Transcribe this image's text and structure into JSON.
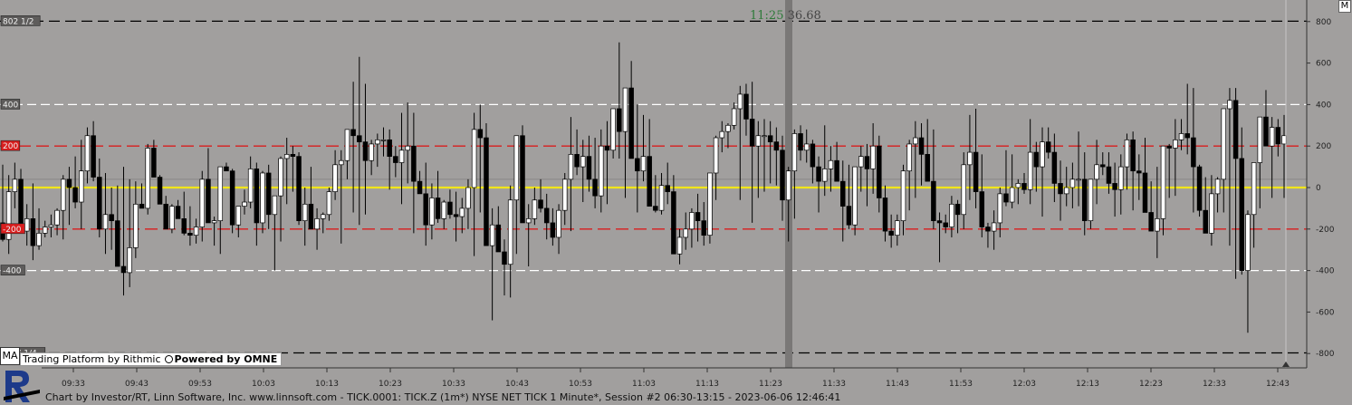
{
  "overlay": {
    "time_label": "11:25",
    "price_label": "36.68",
    "ma_label": "MA",
    "rithmic_text": "Trading Platform by Rithmic",
    "omne_text": "Powered by OMNE",
    "corner_label": "M",
    "footer_text": "Chart by Investor/RT, Linn Software, Inc. www.linnsoft.com - TICK.0001: TICK.Z (1m*) NYSE NET TICK 1 Minute*, Session #2 06:30-13:15 - 2023-06-06 12:46:41"
  },
  "colors": {
    "background": "#a19f9e",
    "bull_fill": "#ffffff",
    "bear_fill": "#000000",
    "wick": "#000000",
    "zero_line": "#f2e61a",
    "red_line": "#d91e1e",
    "white_line": "#ffffff",
    "dark_line": "#000000",
    "cursor": "#7a7877"
  },
  "chart_data": {
    "type": "candlestick",
    "title": "",
    "xlabel": "",
    "ylabel": "",
    "ylim": [
      -900,
      900
    ],
    "y_ticks": [
      800,
      600,
      400,
      200,
      0,
      -200,
      -400,
      -600,
      -800
    ],
    "x_ticks": [
      "09:33",
      "09:43",
      "09:53",
      "10:03",
      "10:13",
      "10:23",
      "10:33",
      "10:43",
      "10:53",
      "11:03",
      "11:13",
      "11:23",
      "11:33",
      "11:43",
      "11:53",
      "12:03",
      "12:13",
      "12:23",
      "12:33",
      "12:43"
    ],
    "grid": false,
    "horizontal_levels": [
      {
        "value": 802,
        "style": "dark-dashed",
        "label": "802 1/2"
      },
      {
        "value": 400,
        "style": "white-dashed",
        "label": "400"
      },
      {
        "value": 200,
        "style": "red-dashed",
        "label": "200"
      },
      {
        "value": 0,
        "style": "yellow-solid",
        "label": ""
      },
      {
        "value": -200,
        "style": "red-dashed",
        "label": "-200"
      },
      {
        "value": -400,
        "style": "white-dashed",
        "label": "-400"
      },
      {
        "value": -797,
        "style": "dark-dashed",
        "label": "-797 1/4"
      }
    ],
    "cursor_time": "11:25",
    "cursor_value": 36.68,
    "candles": [
      [
        -170,
        110,
        -260,
        -250
      ],
      [
        -250,
        60,
        -320,
        -20
      ],
      [
        -20,
        120,
        -100,
        40
      ],
      [
        40,
        90,
        -120,
        -210
      ],
      [
        -210,
        -80,
        -280,
        -150
      ],
      [
        -150,
        20,
        -350,
        -280
      ],
      [
        -280,
        -100,
        -300,
        -220
      ],
      [
        -220,
        -160,
        -240,
        -190
      ],
      [
        -190,
        -130,
        -240,
        -180
      ],
      [
        -180,
        -100,
        -230,
        -110
      ],
      [
        -110,
        60,
        -250,
        40
      ],
      [
        40,
        100,
        -180,
        0
      ],
      [
        0,
        150,
        -100,
        -70
      ],
      [
        -70,
        230,
        -200,
        80
      ],
      [
        80,
        290,
        20,
        250
      ],
      [
        250,
        320,
        30,
        50
      ],
      [
        50,
        140,
        -240,
        -200
      ],
      [
        -200,
        70,
        -320,
        -130
      ],
      [
        -130,
        0,
        -300,
        -160
      ],
      [
        -160,
        10,
        -360,
        -380
      ],
      [
        -380,
        100,
        -520,
        -410
      ],
      [
        -410,
        40,
        -480,
        -290
      ],
      [
        -290,
        30,
        -340,
        -80
      ],
      [
        -80,
        20,
        -100,
        -100
      ],
      [
        -100,
        210,
        -130,
        190
      ],
      [
        190,
        230,
        80,
        50
      ],
      [
        50,
        60,
        -20,
        -80
      ],
      [
        -80,
        -40,
        -200,
        -200
      ],
      [
        -200,
        -80,
        -220,
        -90
      ],
      [
        -90,
        -60,
        -130,
        -150
      ],
      [
        -150,
        -20,
        -230,
        -220
      ],
      [
        -220,
        -90,
        -280,
        -230
      ],
      [
        -230,
        -150,
        -270,
        -190
      ],
      [
        -190,
        80,
        -260,
        40
      ],
      [
        40,
        190,
        -150,
        -170
      ],
      [
        -170,
        -140,
        -280,
        -160
      ],
      [
        -160,
        90,
        -320,
        100
      ],
      [
        100,
        120,
        80,
        80
      ],
      [
        80,
        90,
        -220,
        -180
      ],
      [
        -180,
        -100,
        -240,
        -90
      ],
      [
        -90,
        -10,
        -130,
        -70
      ],
      [
        -70,
        150,
        -100,
        90
      ],
      [
        90,
        120,
        -280,
        -170
      ],
      [
        -170,
        80,
        -220,
        70
      ],
      [
        70,
        110,
        -200,
        -130
      ],
      [
        -130,
        -40,
        -400,
        -40
      ],
      [
        -40,
        150,
        -260,
        140
      ],
      [
        140,
        240,
        -80,
        160
      ],
      [
        160,
        200,
        -20,
        150
      ],
      [
        150,
        170,
        -180,
        -160
      ],
      [
        -160,
        0,
        -280,
        -80
      ],
      [
        -80,
        100,
        -170,
        -200
      ],
      [
        -200,
        -100,
        -300,
        -150
      ],
      [
        -150,
        -120,
        -220,
        -130
      ],
      [
        -130,
        0,
        -160,
        -20
      ],
      [
        -20,
        180,
        -60,
        110
      ],
      [
        110,
        180,
        -270,
        130
      ],
      [
        130,
        260,
        40,
        280
      ],
      [
        280,
        510,
        -120,
        250
      ],
      [
        250,
        630,
        -180,
        220
      ],
      [
        220,
        500,
        -130,
        130
      ],
      [
        130,
        230,
        60,
        210
      ],
      [
        210,
        260,
        100,
        230
      ],
      [
        230,
        290,
        150,
        230
      ],
      [
        230,
        280,
        -10,
        150
      ],
      [
        150,
        200,
        50,
        120
      ],
      [
        120,
        360,
        -80,
        180
      ],
      [
        180,
        410,
        20,
        200
      ],
      [
        200,
        360,
        -220,
        30
      ],
      [
        30,
        80,
        -30,
        -30
      ],
      [
        -30,
        120,
        -280,
        -180
      ],
      [
        -180,
        20,
        -250,
        -50
      ],
      [
        -50,
        80,
        -170,
        -150
      ],
      [
        -150,
        -60,
        -200,
        -70
      ],
      [
        -70,
        -10,
        -150,
        -130
      ],
      [
        -130,
        -20,
        -260,
        -140
      ],
      [
        -140,
        -50,
        -220,
        -100
      ],
      [
        -100,
        40,
        -200,
        0
      ],
      [
        0,
        360,
        -330,
        280
      ],
      [
        280,
        400,
        -120,
        240
      ],
      [
        240,
        310,
        -100,
        -280
      ],
      [
        -280,
        -100,
        -640,
        -180
      ],
      [
        -180,
        -90,
        -280,
        -310
      ],
      [
        -310,
        -250,
        -520,
        -370
      ],
      [
        -370,
        10,
        -530,
        -60
      ],
      [
        -60,
        210,
        -320,
        250
      ],
      [
        250,
        300,
        -140,
        -170
      ],
      [
        -170,
        -80,
        -380,
        -150
      ],
      [
        -150,
        0,
        -180,
        -60
      ],
      [
        -60,
        40,
        -120,
        -100
      ],
      [
        -100,
        -30,
        -250,
        -170
      ],
      [
        -170,
        -100,
        -280,
        -240
      ],
      [
        -240,
        -80,
        -320,
        -110
      ],
      [
        -110,
        70,
        -180,
        40
      ],
      [
        40,
        340,
        -210,
        160
      ],
      [
        160,
        280,
        60,
        100
      ],
      [
        100,
        230,
        -70,
        150
      ],
      [
        150,
        250,
        -20,
        40
      ],
      [
        40,
        240,
        -100,
        -40
      ],
      [
        -40,
        280,
        -120,
        200
      ],
      [
        200,
        320,
        -80,
        180
      ],
      [
        180,
        380,
        140,
        380
      ],
      [
        380,
        700,
        140,
        270
      ],
      [
        270,
        460,
        -50,
        480
      ],
      [
        480,
        610,
        170,
        140
      ],
      [
        140,
        400,
        -120,
        80
      ],
      [
        80,
        350,
        30,
        150
      ],
      [
        150,
        330,
        40,
        -90
      ],
      [
        -90,
        60,
        -120,
        -110
      ],
      [
        -110,
        70,
        -130,
        10
      ],
      [
        10,
        120,
        -80,
        -20
      ],
      [
        -20,
        60,
        -300,
        -320
      ],
      [
        -320,
        -200,
        -370,
        -240
      ],
      [
        -240,
        -120,
        -300,
        -200
      ],
      [
        -200,
        -100,
        -290,
        -120
      ],
      [
        -120,
        -30,
        -260,
        -160
      ],
      [
        -160,
        -70,
        -280,
        -230
      ],
      [
        -230,
        70,
        -270,
        70
      ],
      [
        70,
        250,
        -60,
        240
      ],
      [
        240,
        320,
        170,
        270
      ],
      [
        270,
        310,
        190,
        300
      ],
      [
        300,
        410,
        280,
        380
      ],
      [
        380,
        490,
        -60,
        450
      ],
      [
        450,
        500,
        250,
        330
      ],
      [
        330,
        510,
        -170,
        200
      ],
      [
        200,
        320,
        -50,
        250
      ],
      [
        250,
        330,
        -20,
        250
      ],
      [
        250,
        320,
        20,
        220
      ],
      [
        220,
        290,
        10,
        180
      ],
      [
        180,
        250,
        -160,
        -60
      ],
      [
        -60,
        100,
        -260,
        80
      ],
      [
        80,
        280,
        -150,
        260
      ],
      [
        260,
        300,
        130,
        180
      ],
      [
        180,
        280,
        120,
        210
      ],
      [
        210,
        230,
        20,
        100
      ],
      [
        100,
        150,
        -120,
        30
      ],
      [
        30,
        300,
        -40,
        90
      ],
      [
        90,
        200,
        -20,
        130
      ],
      [
        130,
        220,
        50,
        30
      ],
      [
        30,
        130,
        -260,
        -90
      ],
      [
        -90,
        110,
        -200,
        -180
      ],
      [
        -180,
        40,
        -230,
        100
      ],
      [
        100,
        200,
        -20,
        150
      ],
      [
        150,
        210,
        -90,
        90
      ],
      [
        90,
        310,
        -30,
        200
      ],
      [
        200,
        250,
        -120,
        -50
      ],
      [
        -50,
        10,
        -260,
        -210
      ],
      [
        -210,
        -130,
        -290,
        -230
      ],
      [
        -230,
        -130,
        -280,
        -160
      ],
      [
        -160,
        110,
        -230,
        80
      ],
      [
        80,
        230,
        -110,
        210
      ],
      [
        210,
        320,
        -50,
        240
      ],
      [
        240,
        310,
        10,
        160
      ],
      [
        160,
        330,
        70,
        30
      ],
      [
        30,
        280,
        -200,
        -160
      ],
      [
        -160,
        -120,
        -360,
        -170
      ],
      [
        -170,
        -130,
        -220,
        -190
      ],
      [
        -190,
        -40,
        -240,
        -80
      ],
      [
        -80,
        -60,
        -220,
        -130
      ],
      [
        -130,
        170,
        -200,
        110
      ],
      [
        110,
        350,
        -60,
        170
      ],
      [
        170,
        380,
        -100,
        -20
      ],
      [
        -20,
        160,
        -240,
        -190
      ],
      [
        -190,
        -170,
        -290,
        -210
      ],
      [
        -210,
        -110,
        -300,
        -170
      ],
      [
        -170,
        0,
        -240,
        -30
      ],
      [
        -30,
        180,
        -90,
        -70
      ],
      [
        -70,
        160,
        -100,
        0
      ],
      [
        0,
        40,
        -80,
        20
      ],
      [
        20,
        70,
        -30,
        -10
      ],
      [
        -10,
        330,
        -80,
        170
      ],
      [
        170,
        220,
        -20,
        100
      ],
      [
        100,
        290,
        -140,
        220
      ],
      [
        220,
        290,
        140,
        170
      ],
      [
        170,
        260,
        -70,
        20
      ],
      [
        20,
        130,
        -160,
        -30
      ],
      [
        -30,
        100,
        -90,
        0
      ],
      [
        0,
        120,
        -100,
        40
      ],
      [
        40,
        270,
        -90,
        40
      ],
      [
        40,
        170,
        -230,
        -160
      ],
      [
        -160,
        40,
        -200,
        40
      ],
      [
        40,
        230,
        -80,
        110
      ],
      [
        110,
        170,
        60,
        100
      ],
      [
        100,
        170,
        -30,
        20
      ],
      [
        20,
        120,
        -140,
        -10
      ],
      [
        -10,
        160,
        -130,
        100
      ],
      [
        100,
        260,
        -10,
        230
      ],
      [
        230,
        270,
        -110,
        80
      ],
      [
        80,
        160,
        -60,
        70
      ],
      [
        70,
        240,
        -50,
        -120
      ],
      [
        -120,
        30,
        -210,
        -210
      ],
      [
        -210,
        100,
        -340,
        -150
      ],
      [
        -150,
        160,
        -230,
        200
      ],
      [
        200,
        210,
        -50,
        190
      ],
      [
        190,
        330,
        -40,
        230
      ],
      [
        230,
        330,
        180,
        260
      ],
      [
        260,
        500,
        160,
        240
      ],
      [
        240,
        480,
        -120,
        100
      ],
      [
        100,
        110,
        -140,
        -110
      ],
      [
        -110,
        50,
        -190,
        -220
      ],
      [
        -220,
        60,
        -280,
        -30
      ],
      [
        -30,
        50,
        -120,
        40
      ],
      [
        40,
        190,
        -120,
        380
      ],
      [
        380,
        480,
        -280,
        420
      ],
      [
        420,
        480,
        -440,
        140
      ],
      [
        140,
        290,
        -420,
        -400
      ],
      [
        -400,
        -110,
        -700,
        -130
      ],
      [
        -130,
        20,
        -290,
        120
      ],
      [
        120,
        240,
        -100,
        340
      ],
      [
        340,
        470,
        210,
        200
      ],
      [
        200,
        340,
        -50,
        290
      ],
      [
        290,
        330,
        150,
        210
      ],
      [
        210,
        350,
        -50,
        250
      ]
    ]
  }
}
